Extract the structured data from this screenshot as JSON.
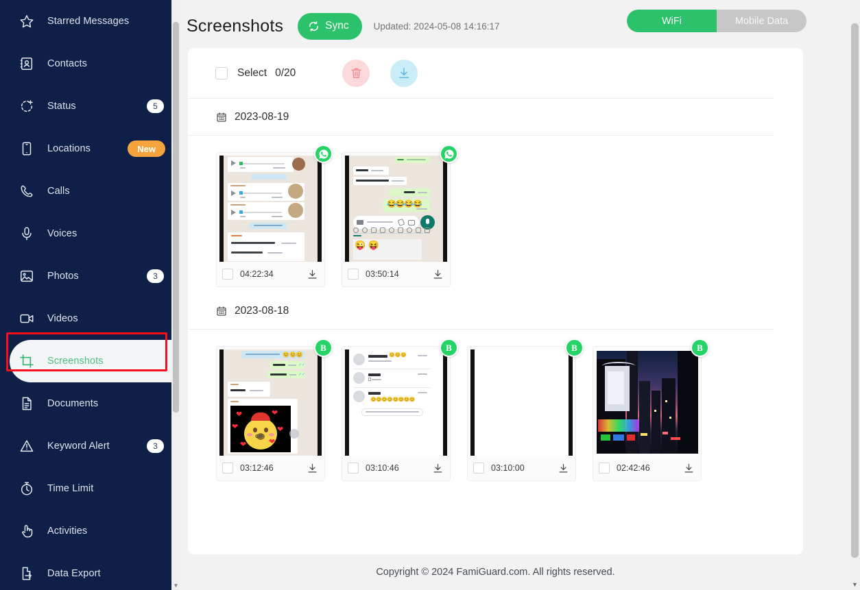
{
  "sidebar": {
    "items": [
      {
        "label": "Starred Messages",
        "icon": "star-icon",
        "badge": null,
        "badge_type": null,
        "active": false
      },
      {
        "label": "Contacts",
        "icon": "contacts-icon",
        "badge": null,
        "badge_type": null,
        "active": false
      },
      {
        "label": "Status",
        "icon": "status-icon",
        "badge": "5",
        "badge_type": "count",
        "active": false
      },
      {
        "label": "Locations",
        "icon": "phone-icon",
        "badge": "New",
        "badge_type": "new",
        "active": false
      },
      {
        "label": "Calls",
        "icon": "call-icon",
        "badge": null,
        "badge_type": null,
        "active": false
      },
      {
        "label": "Voices",
        "icon": "microphone-icon",
        "badge": null,
        "badge_type": null,
        "active": false
      },
      {
        "label": "Photos",
        "icon": "image-icon",
        "badge": "3",
        "badge_type": "count",
        "active": false
      },
      {
        "label": "Videos",
        "icon": "video-icon",
        "badge": null,
        "badge_type": null,
        "active": false
      },
      {
        "label": "Screenshots",
        "icon": "crop-icon",
        "badge": null,
        "badge_type": null,
        "active": true
      },
      {
        "label": "Documents",
        "icon": "document-icon",
        "badge": null,
        "badge_type": null,
        "active": false
      },
      {
        "label": "Keyword Alert",
        "icon": "warning-icon",
        "badge": "3",
        "badge_type": "count",
        "active": false
      },
      {
        "label": "Time Limit",
        "icon": "timer-icon",
        "badge": null,
        "badge_type": null,
        "active": false
      },
      {
        "label": "Activities",
        "icon": "hand-tap-icon",
        "badge": null,
        "badge_type": null,
        "active": false
      },
      {
        "label": "Data Export",
        "icon": "export-icon",
        "badge": null,
        "badge_type": null,
        "active": false
      }
    ],
    "active_highlight_color": "#fc0d1b"
  },
  "header": {
    "title": "Screenshots",
    "sync_label": "Sync",
    "updated_text": "Updated: 2024-05-08 14:16:17",
    "network_toggle": {
      "options": [
        "WiFi",
        "Mobile Data"
      ],
      "selected": "WiFi",
      "active_color": "#2cc16b",
      "inactive_color": "#c7c7c7"
    }
  },
  "toolbar": {
    "select_label": "Select",
    "select_count": "0/20",
    "delete_icon": "trash-icon",
    "download_icon": "download-icon",
    "delete_bg": "#fbd9da",
    "download_bg": "#c9ecf7"
  },
  "groups": [
    {
      "date": "2023-08-19",
      "items": [
        {
          "time": "04:22:34",
          "app_badge": "whatsapp",
          "preview": "whatsapp-voice-chat"
        },
        {
          "time": "03:50:14",
          "app_badge": "whatsapp",
          "preview": "whatsapp-text-chat"
        }
      ]
    },
    {
      "date": "2023-08-18",
      "items": [
        {
          "time": "03:12:46",
          "app_badge": "whatsapp-business",
          "preview": "whatsapp-sticker-chat"
        },
        {
          "time": "03:10:46",
          "app_badge": "whatsapp-business",
          "preview": "whatsapp-chat-list"
        },
        {
          "time": "03:10:00",
          "app_badge": "whatsapp-business",
          "preview": "blank-screen"
        },
        {
          "time": "02:42:46",
          "app_badge": "whatsapp-business",
          "preview": "city-photo"
        }
      ]
    }
  ],
  "footer": {
    "copyright": "Copyright © 2024 FamiGuard.com. All rights reserved."
  }
}
